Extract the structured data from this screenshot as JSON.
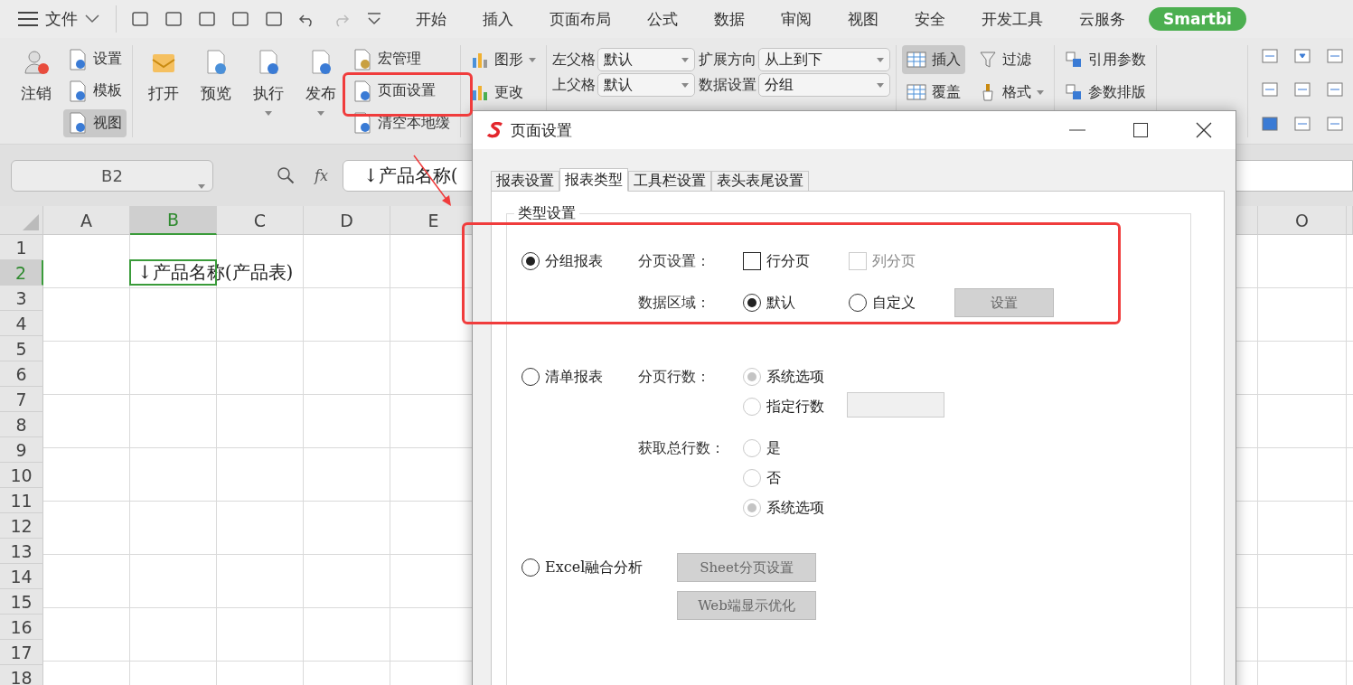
{
  "menu": {
    "label": "文件"
  },
  "tabs": [
    {
      "label": "开始",
      "selected": false
    },
    {
      "label": "插入",
      "selected": false
    },
    {
      "label": "页面布局",
      "selected": false
    },
    {
      "label": "公式",
      "selected": false
    },
    {
      "label": "数据",
      "selected": false
    },
    {
      "label": "审阅",
      "selected": false
    },
    {
      "label": "视图",
      "selected": false
    },
    {
      "label": "安全",
      "selected": false
    },
    {
      "label": "开发工具",
      "selected": false
    },
    {
      "label": "云服务",
      "selected": false
    },
    {
      "label": "Smartbi",
      "selected": true
    }
  ],
  "ribbon": {
    "account": {
      "large": "注销",
      "small": [
        {
          "label": "设置",
          "selected": false
        },
        {
          "label": "模板",
          "selected": false
        },
        {
          "label": "视图",
          "selected": true
        }
      ]
    },
    "report": {
      "large": [
        {
          "label": "打开",
          "dropdown": false
        },
        {
          "label": "预览",
          "dropdown": false
        },
        {
          "label": "执行",
          "dropdown": true
        },
        {
          "label": "发布",
          "dropdown": true
        }
      ],
      "small": [
        "宏管理",
        "页面设置",
        "清空本地缓"
      ]
    },
    "chart": [
      {
        "label": "图形",
        "dropdown": true
      },
      {
        "label": "更改",
        "dropdown": false
      }
    ],
    "parent_fields": [
      {
        "label": "左父格",
        "value": "默认",
        "disabled": false
      },
      {
        "label": "上父格",
        "value": "默认",
        "disabled": false
      }
    ],
    "data_fields": [
      {
        "label": "扩展方向",
        "value": "从上到下",
        "disabled": false
      },
      {
        "label": "数据设置",
        "value": "分组",
        "disabled": false
      }
    ],
    "mode": [
      {
        "label": "插入",
        "selected": true
      },
      {
        "label": "覆盖",
        "selected": false
      }
    ],
    "format": [
      {
        "label": "过滤",
        "dropdown": false
      },
      {
        "label": "格式",
        "dropdown": true
      }
    ],
    "params": [
      "引用参数",
      "参数排版"
    ]
  },
  "sheet": {
    "name_box": "B2",
    "function_label": "fx",
    "formula": "↓产品名称(",
    "columns": [
      {
        "label": "A",
        "selected": false
      },
      {
        "label": "B",
        "selected": true
      },
      {
        "label": "C",
        "selected": false
      },
      {
        "label": "D",
        "selected": false
      },
      {
        "label": "E",
        "selected": false
      },
      {
        "label": "O",
        "selected": false
      }
    ],
    "rows": [
      {
        "label": "1",
        "selected": false
      },
      {
        "label": "2",
        "selected": true
      },
      {
        "label": "3",
        "selected": false
      },
      {
        "label": "4",
        "selected": false
      },
      {
        "label": "5",
        "selected": false
      },
      {
        "label": "6",
        "selected": false
      },
      {
        "label": "7",
        "selected": false
      },
      {
        "label": "8",
        "selected": false
      },
      {
        "label": "9",
        "selected": false
      },
      {
        "label": "10",
        "selected": false
      },
      {
        "label": "11",
        "selected": false
      },
      {
        "label": "12",
        "selected": false
      },
      {
        "label": "13",
        "selected": false
      },
      {
        "label": "14",
        "selected": false
      },
      {
        "label": "15",
        "selected": false
      },
      {
        "label": "16",
        "selected": false
      },
      {
        "label": "17",
        "selected": false
      },
      {
        "label": "18",
        "selected": false
      }
    ],
    "active_cell_text": "↓产品名称(产品表)"
  },
  "dialog": {
    "title": "页面设置",
    "tabs": [
      {
        "label": "报表设置",
        "selected": false
      },
      {
        "label": "报表类型",
        "selected": true
      },
      {
        "label": "工具栏设置",
        "selected": false
      },
      {
        "label": "表头表尾设置",
        "selected": false
      }
    ],
    "group_title": "类型设置",
    "report_types": [
      {
        "label": "分组报表",
        "selected": true,
        "options": [
          {
            "label": "分页设置：",
            "kind": "inline",
            "items": [
              {
                "kind": "checkbox",
                "label": "行分页",
                "checked": false,
                "disabled": false
              },
              {
                "kind": "checkbox",
                "label": "列分页",
                "checked": false,
                "disabled": true
              }
            ]
          },
          {
            "label": "数据区域：",
            "kind": "inline",
            "items": [
              {
                "kind": "radio",
                "label": "默认",
                "selected": true,
                "disabled": false
              },
              {
                "kind": "radio",
                "label": "自定义",
                "selected": false,
                "disabled": false
              },
              {
                "kind": "button",
                "label": "设置"
              }
            ]
          }
        ]
      },
      {
        "label": "清单报表",
        "selected": false,
        "options": [
          {
            "label": "分页行数：",
            "kind": "stacked",
            "items": [
              {
                "kind": "radio",
                "label": "系统选项",
                "selected": true,
                "disabled": true
              },
              {
                "kind": "radio_input",
                "label": "指定行数",
                "selected": false,
                "disabled": true
              }
            ]
          },
          {
            "label": "获取总行数：",
            "kind": "stacked",
            "items": [
              {
                "kind": "radio",
                "label": "是",
                "selected": false,
                "disabled": true
              },
              {
                "kind": "radio",
                "label": "否",
                "selected": false,
                "disabled": true
              },
              {
                "kind": "radio",
                "label": "系统选项",
                "selected": true,
                "disabled": true
              }
            ]
          }
        ]
      },
      {
        "label": "Excel融合分析",
        "selected": false,
        "buttons": [
          "Sheet分页设置",
          "Web端显示优化"
        ]
      }
    ]
  }
}
